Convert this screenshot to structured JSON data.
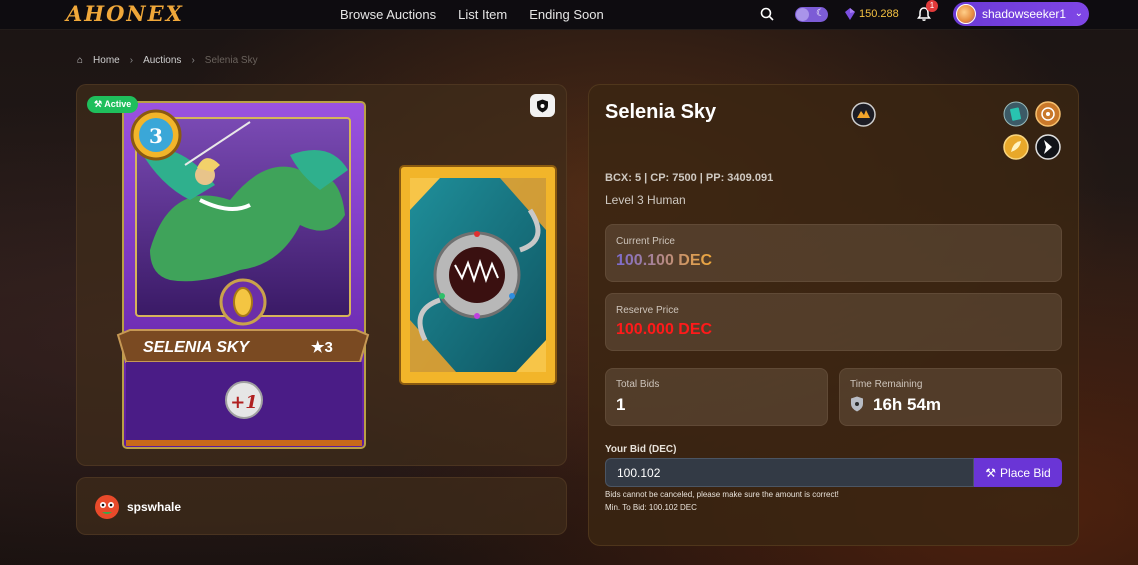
{
  "header": {
    "logo": "AHONEX",
    "nav": [
      "Browse Auctions",
      "List Item",
      "Ending Soon"
    ],
    "balance": "150.288",
    "notification_count": "1",
    "username": "shadowseeker1"
  },
  "breadcrumb": [
    "Home",
    "Auctions",
    "Selenia Sky"
  ],
  "listing": {
    "status": "Active",
    "owner": "spswhale"
  },
  "card_art": {
    "level": "3",
    "name": "SELENIA SKY",
    "stars": "★3",
    "ability_text": "+1"
  },
  "details": {
    "title": "Selenia Sky",
    "meta": "BCX: 5 | CP: 7500 | PP: 3409.091",
    "level_race": "Level 3 Human",
    "current_price_label": "Current Price",
    "current_price": "100.100 DEC",
    "reserve_price_label": "Reserve Price",
    "reserve_price": "100.000 DEC",
    "total_bids_label": "Total Bids",
    "total_bids": "1",
    "time_remaining_label": "Time Remaining",
    "time_remaining": "16h 54m",
    "your_bid_label": "Your Bid (DEC)",
    "your_bid_value": "100.102",
    "place_bid_label": "Place Bid",
    "warning": "Bids cannot be canceled, please make sure the amount is correct!",
    "min_bid": "Min. To Bid: 100.102 DEC"
  },
  "colors": {
    "accent_purple": "#6a35d6",
    "active_green": "#1fbf5c",
    "reserve_red": "#ff1a1a",
    "logo_orange": "#f0a83a"
  }
}
